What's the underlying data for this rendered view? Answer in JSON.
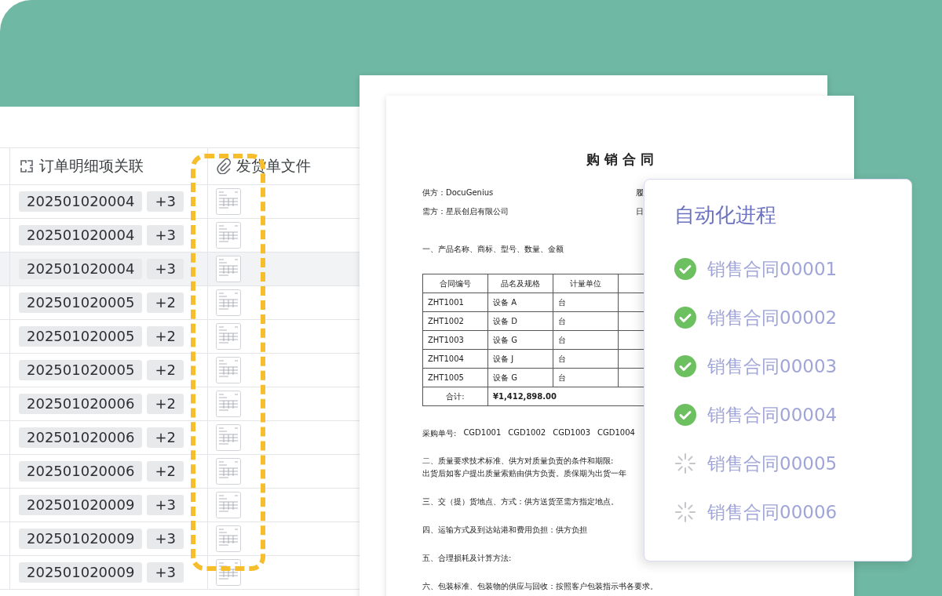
{
  "table": {
    "columns": [
      {
        "kind": "link",
        "label": "订单明细项关联"
      },
      {
        "kind": "attachment",
        "label": "发货单文件"
      }
    ],
    "rows": [
      {
        "order": "202501020004",
        "more": "+3",
        "selected": false
      },
      {
        "order": "202501020004",
        "more": "+3",
        "selected": false
      },
      {
        "order": "202501020004",
        "more": "+3",
        "selected": true
      },
      {
        "order": "202501020005",
        "more": "+2",
        "selected": false
      },
      {
        "order": "202501020005",
        "more": "+2",
        "selected": false
      },
      {
        "order": "202501020005",
        "more": "+2",
        "selected": false
      },
      {
        "order": "202501020006",
        "more": "+2",
        "selected": false
      },
      {
        "order": "202501020006",
        "more": "+2",
        "selected": false
      },
      {
        "order": "202501020006",
        "more": "+2",
        "selected": false
      },
      {
        "order": "202501020009",
        "more": "+3",
        "selected": false
      },
      {
        "order": "202501020009",
        "more": "+3",
        "selected": false
      },
      {
        "order": "202501020009",
        "more": "+3",
        "selected": false
      }
    ]
  },
  "document": {
    "title": "购 销 合 同",
    "parties": [
      {
        "text": "供方：DocuGenius",
        "right": "履"
      },
      {
        "text": "需方：星辰创启有限公司",
        "right": "日"
      }
    ],
    "section_1": "一、产品名称、商标、型号、数量、金额",
    "table": {
      "columns": [
        "合同编号",
        "品名及规格",
        "计量单位"
      ],
      "rows": [
        [
          "ZHT1001",
          "设备 A",
          "台"
        ],
        [
          "ZHT1002",
          "设备 D",
          "台"
        ],
        [
          "ZHT1003",
          "设备 G",
          "台"
        ],
        [
          "ZHT1004",
          "设备 J",
          "台"
        ],
        [
          "ZHT1005",
          "设备 G",
          "台"
        ]
      ],
      "total_label": "合计:",
      "total": "¥1,412,898.00"
    },
    "po_label": "采购单号:",
    "po_numbers": [
      "CGD1001",
      "CGD1002",
      "CGD1003",
      "CGD1004"
    ],
    "clauses": [
      [
        "二、质量要求技术标准、供方对质量负责的条件和期限:",
        "出货后如客户提出质量索赔由供方负责。质保期为出货一年"
      ],
      [
        "三、交（提）货地点、方式：供方送货至需方指定地点。"
      ],
      [
        "四、运输方式及到达站港和费用负担：供方负担"
      ],
      [
        "五、合理损耗及计算方法:"
      ],
      [
        "六、包装标准、包装物的供应与回收：按照客户包装指示书各要求。"
      ]
    ]
  },
  "progress": {
    "title": "自动化进程",
    "items": [
      {
        "label": "销售合同00001",
        "done": true
      },
      {
        "label": "销售合同00002",
        "done": true
      },
      {
        "label": "销售合同00003",
        "done": true
      },
      {
        "label": "销售合同00004",
        "done": true
      },
      {
        "label": "销售合同00005",
        "done": false
      },
      {
        "label": "销售合同00006",
        "done": false
      }
    ]
  }
}
